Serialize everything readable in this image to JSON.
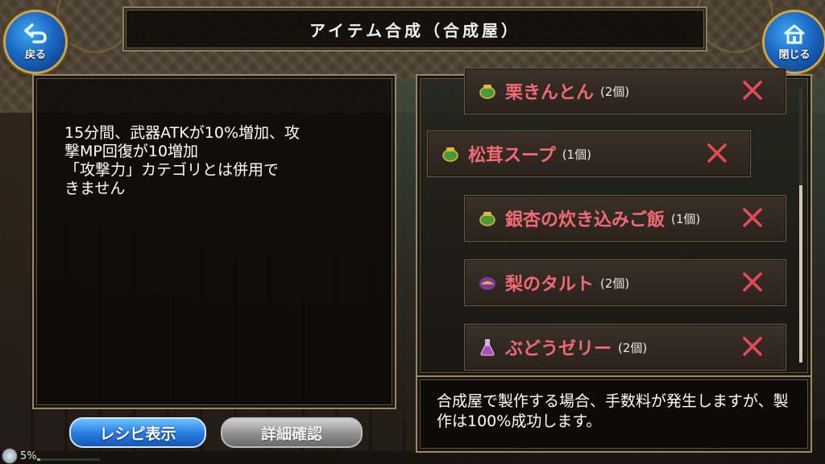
{
  "header": {
    "title": "アイテム合成（合成屋）",
    "back_label": "戻る",
    "close_label": "閉じる"
  },
  "description": {
    "text": "15分間、武器ATKが10%増加、攻\n撃MP回復が10増加\n「攻撃力」カテゴリとは併用で\nきません"
  },
  "items": [
    {
      "name": "栗きんとん",
      "qty": "(2個)",
      "icon": "pot-icon"
    },
    {
      "name": "松茸スープ",
      "qty": "(1個)",
      "icon": "pot-icon"
    },
    {
      "name": "銀杏の炊き込みご飯",
      "qty": "(1個)",
      "icon": "pot-icon"
    },
    {
      "name": "梨のタルト",
      "qty": "(2個)",
      "icon": "tart-icon"
    },
    {
      "name": "ぶどうゼリー",
      "qty": "(2個)",
      "icon": "potion-icon"
    }
  ],
  "info": {
    "text": "合成屋で製作する場合、手数料が発生しますが、製作は100%成功します。"
  },
  "buttons": {
    "recipe_label": "レシピ表示",
    "detail_label": "詳細確認"
  },
  "status": {
    "percent_text": "5%",
    "fill": 0.05
  },
  "colors": {
    "item_name": "#f26a73",
    "remove_x": "#e84a55",
    "accent_blue": "#2c7fe0"
  }
}
